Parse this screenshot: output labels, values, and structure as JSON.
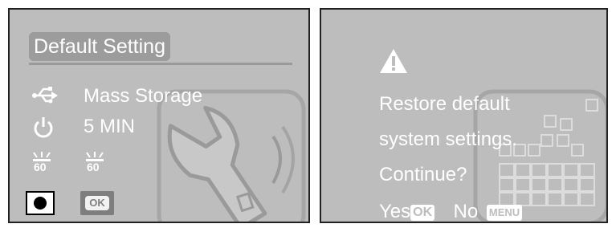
{
  "colors": {
    "panel_bg": "#bdbdbd",
    "text": "#ffffff",
    "accent_gray": "#9c9c9c",
    "border": "#222222"
  },
  "left_screen": {
    "title": "Default Setting",
    "usb_row": {
      "icon": "usb-icon",
      "label": "Mass Storage"
    },
    "power_row": {
      "icon": "power-icon",
      "label": "5 MIN"
    },
    "led_icons": [
      {
        "icon": "led-flash-icon",
        "label": "60"
      },
      {
        "icon": "led-flash-icon",
        "label": "60"
      }
    ],
    "record_icon": "record-icon",
    "ok_label": "OK",
    "watermark": "wrench-settings-icon"
  },
  "right_screen": {
    "warning_icon": "warning-icon",
    "message_lines": [
      "Restore default",
      "system settings.",
      "Continue?"
    ],
    "yes_label": "Yes",
    "yes_key": "OK",
    "no_label": "No",
    "no_key": "MENU",
    "watermark": "calendar-grid-icon"
  }
}
